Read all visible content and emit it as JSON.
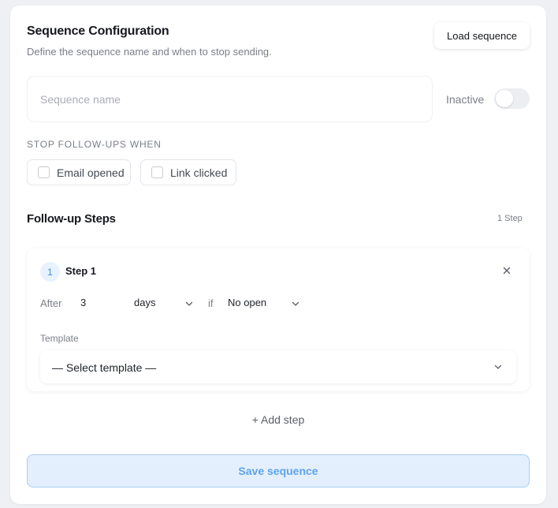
{
  "header": {
    "title": "Sequence Configuration",
    "subtitle": "Define the sequence name and when to stop sending.",
    "load_label": "Load sequence"
  },
  "name_field": {
    "value": "",
    "placeholder": "Sequence name"
  },
  "status": {
    "label": "Inactive",
    "active": false
  },
  "stop_conditions": {
    "label": "Stop follow-ups when",
    "options": [
      {
        "label": "Email opened",
        "checked": false
      },
      {
        "label": "Link clicked",
        "checked": false
      }
    ]
  },
  "steps_section": {
    "title": "Follow-up Steps",
    "count_label": "1 Step",
    "steps": [
      {
        "number": "1",
        "title": "Step 1",
        "after_label": "After",
        "delay_value": "3",
        "delay_unit": "days",
        "if_label": "if",
        "condition": "No open",
        "template_label": "Template",
        "template_value": "— Select template —"
      }
    ],
    "add_label": "+ Add step"
  },
  "footer": {
    "save_label": "Save sequence"
  },
  "colors": {
    "accent": "#3f8ce0",
    "save_bg": "#e3effc",
    "save_border": "#a9cdf4",
    "save_text": "#5fa3ea"
  },
  "icons": {
    "close": "close-icon",
    "dropdown": "chevron-down-icon"
  }
}
